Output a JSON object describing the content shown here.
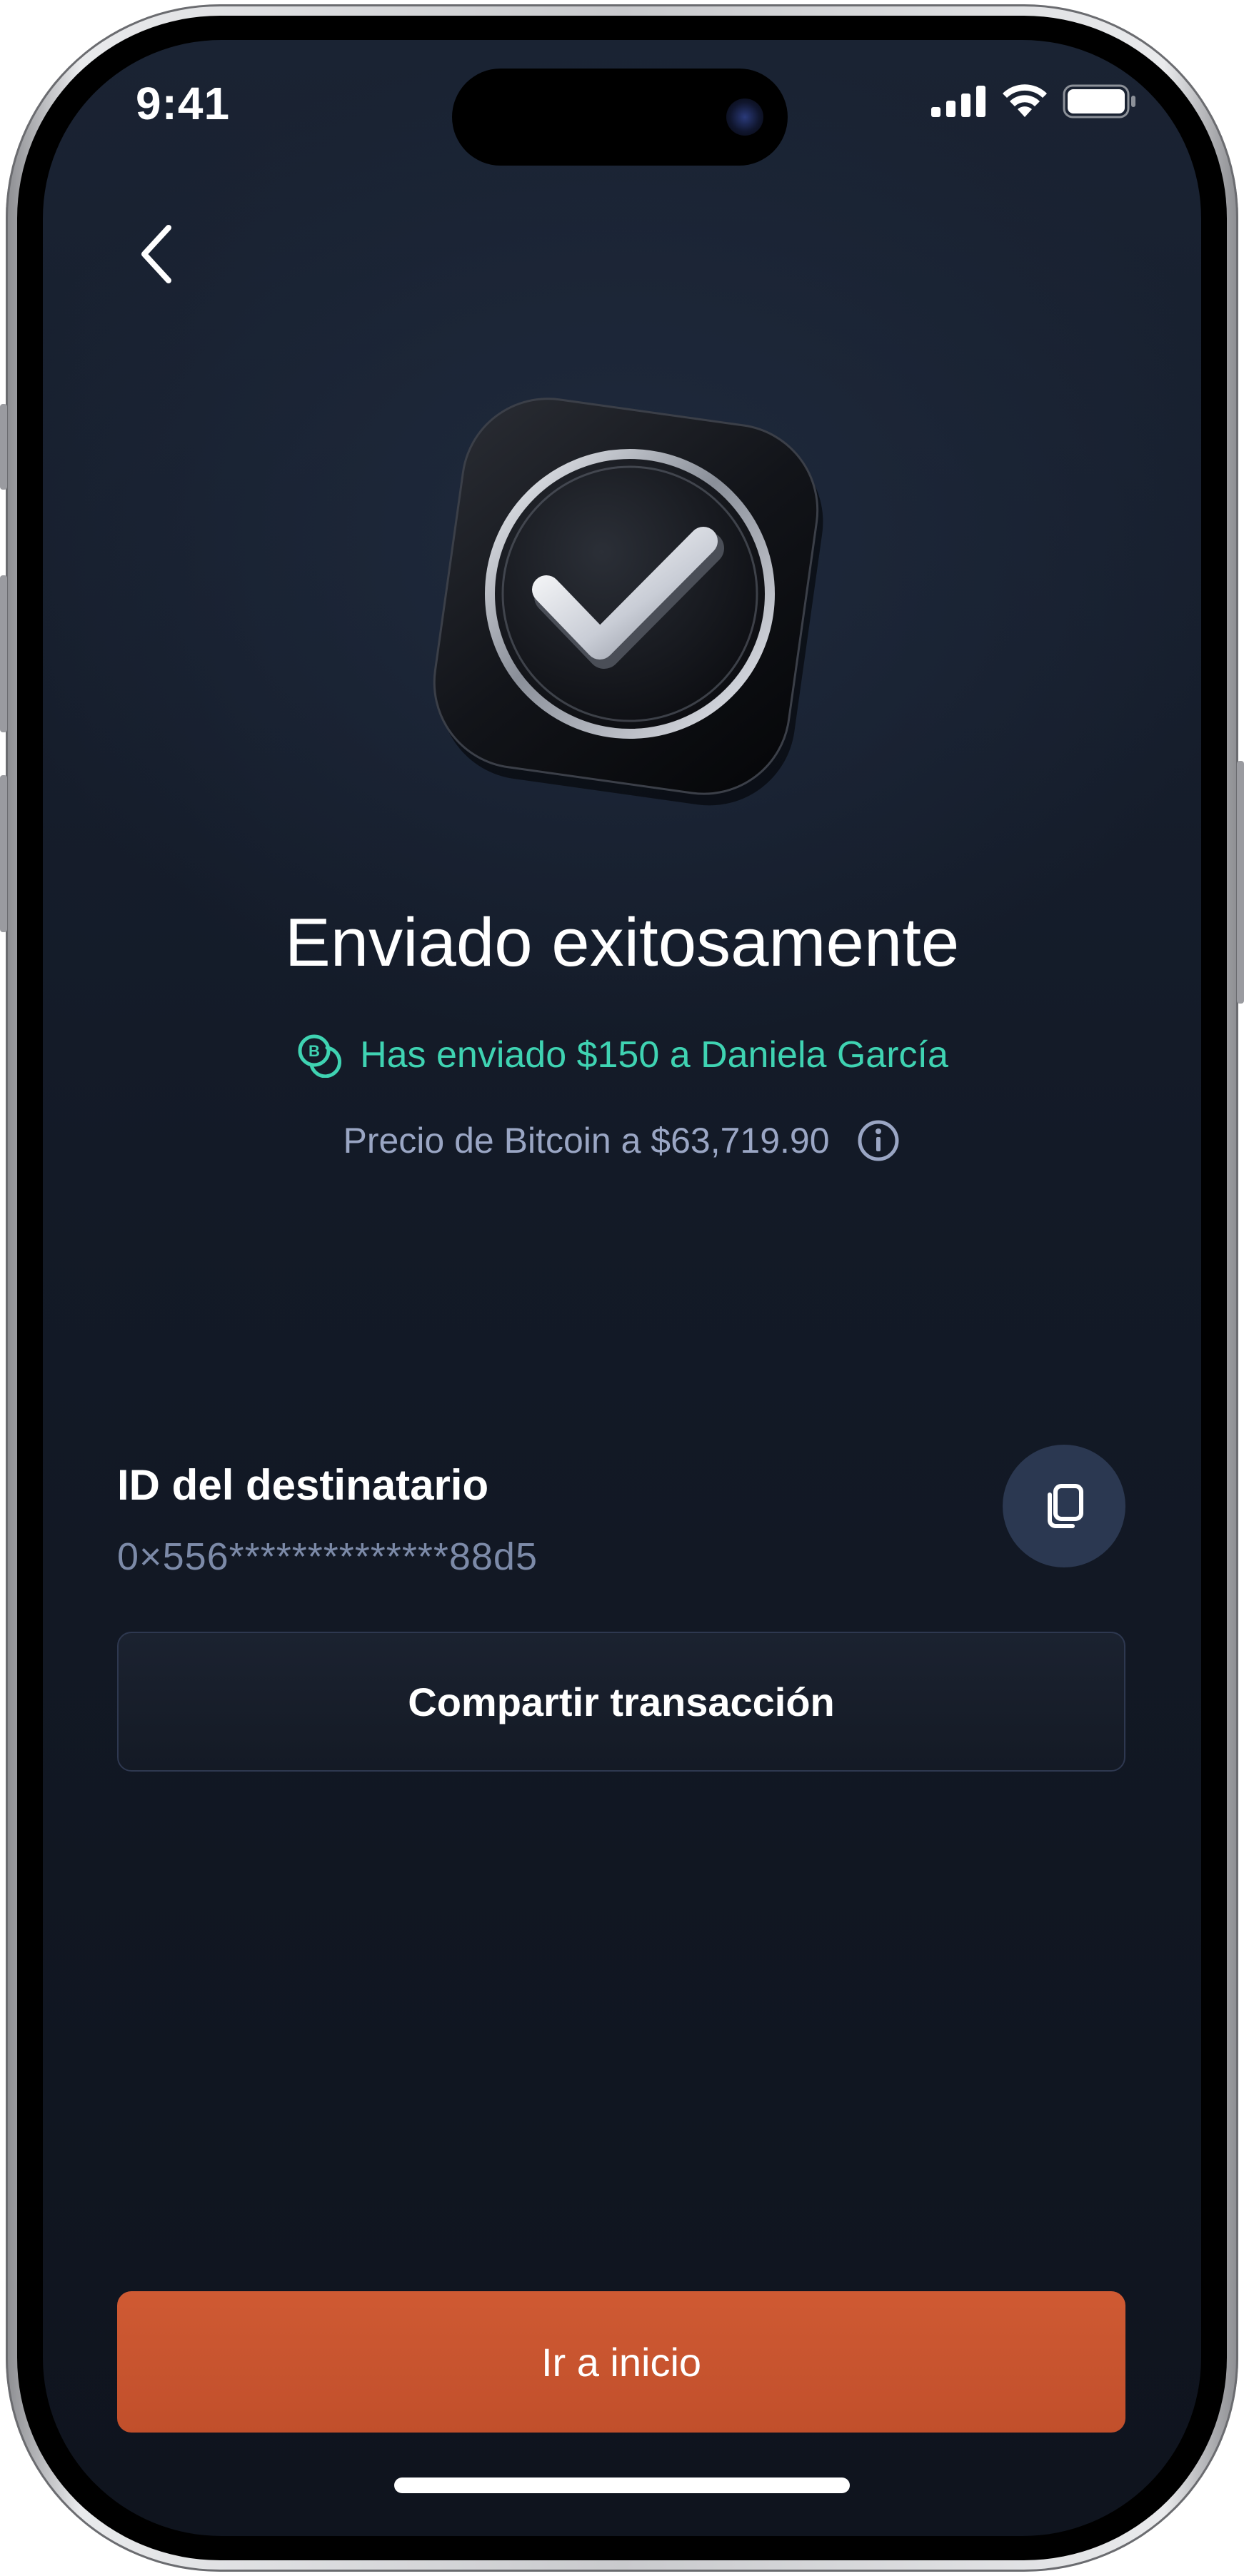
{
  "status_bar": {
    "time": "9:41",
    "icons": [
      "cellular-signal-icon",
      "wifi-icon",
      "battery-icon"
    ]
  },
  "nav": {
    "back_icon": "chevron-left-icon"
  },
  "hero": {
    "icon": "checkmark-badge-icon"
  },
  "confirmation": {
    "title": "Enviado exitosamente",
    "sent_icon": "bitcoin-coins-icon",
    "sent_text": "Has enviado $150 a Daniela García",
    "price_text": "Precio de Bitcoin a $63,719.90",
    "info_icon": "info-icon"
  },
  "recipient": {
    "label": "ID del destinatario",
    "id": "0×556**************88d5",
    "copy_icon": "copy-icon"
  },
  "actions": {
    "share_label": "Compartir transacción",
    "home_label": "Ir a inicio"
  },
  "colors": {
    "background": "#131a27",
    "accent_green": "#3fd3b2",
    "primary_button": "#c9552f",
    "muted_text": "#9aa6c4",
    "copy_button_bg": "#2b3851"
  }
}
